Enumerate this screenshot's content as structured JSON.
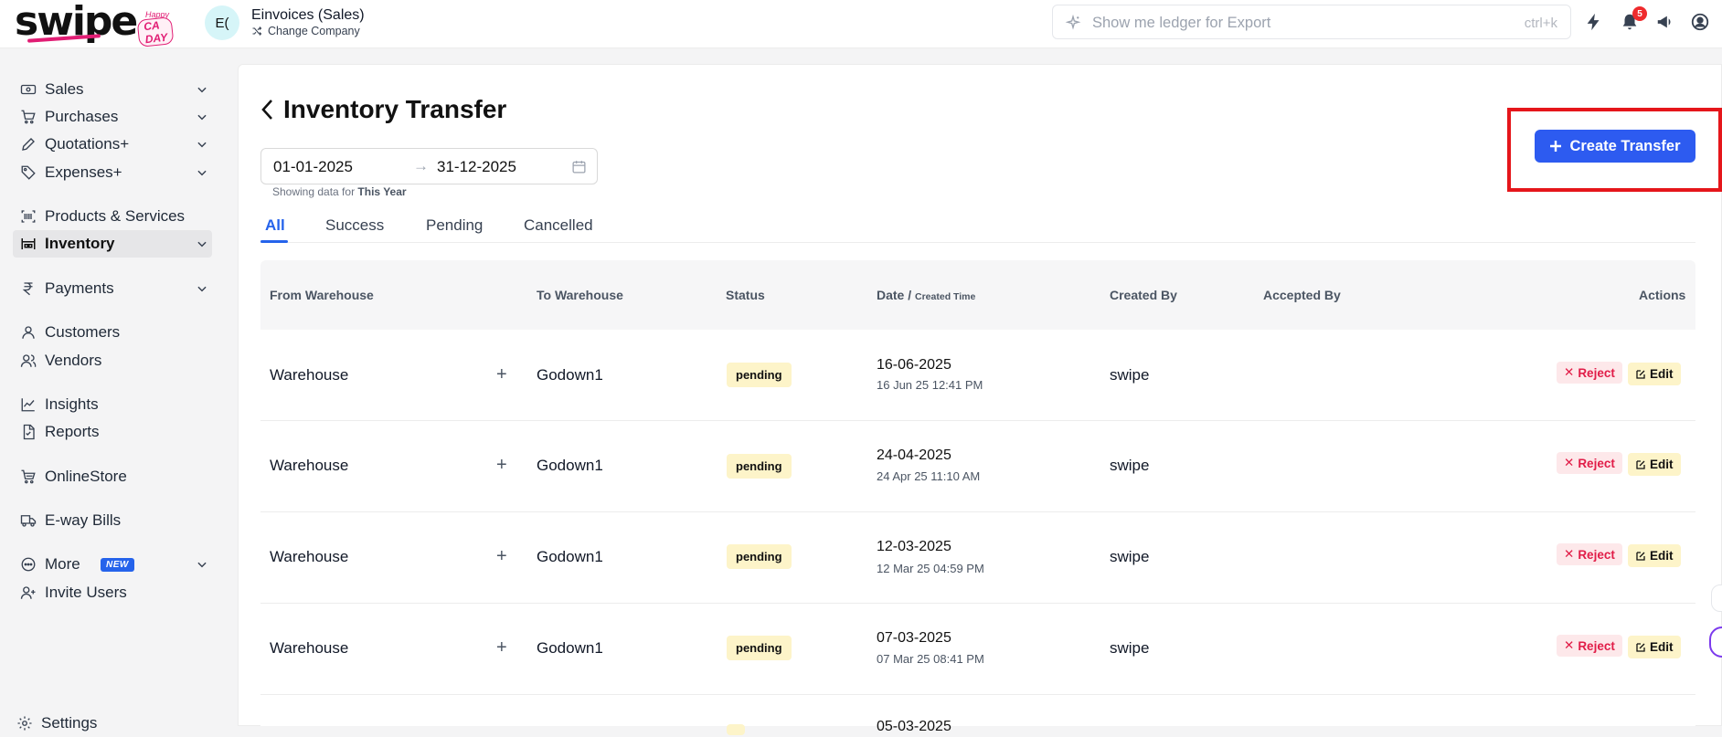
{
  "brand": {
    "word": "swipe",
    "happy": "Happy",
    "ca_day": "CA DAY"
  },
  "company": {
    "avatar": "E(",
    "name": "Einvoices (Sales)",
    "change": "Change Company"
  },
  "search": {
    "placeholder": "Show me ledger for Export",
    "shortcut": "ctrl+k"
  },
  "notifications": {
    "count": "5"
  },
  "sidebar": {
    "items": [
      {
        "label": "Sales"
      },
      {
        "label": "Purchases"
      },
      {
        "label": "Quotations+"
      },
      {
        "label": "Expenses+"
      },
      {
        "label": "Products & Services"
      },
      {
        "label": "Inventory"
      },
      {
        "label": "Payments"
      },
      {
        "label": "Customers"
      },
      {
        "label": "Vendors"
      },
      {
        "label": "Insights"
      },
      {
        "label": "Reports"
      },
      {
        "label": "OnlineStore"
      },
      {
        "label": "E-way Bills"
      },
      {
        "label": "More"
      },
      {
        "label": "Invite Users"
      },
      {
        "label": "Settings"
      }
    ],
    "new_badge": "NEW"
  },
  "page": {
    "title": "Inventory Transfer",
    "date_from": "01-01-2025",
    "date_to": "31-12-2025",
    "arrow": "→",
    "showing_prefix": "Showing data for",
    "showing_period": "This Year",
    "create_label": "Create Transfer"
  },
  "tabs": [
    {
      "label": "All"
    },
    {
      "label": "Success"
    },
    {
      "label": "Pending"
    },
    {
      "label": "Cancelled"
    }
  ],
  "table": {
    "headers": {
      "from": "From Warehouse",
      "to": "To Warehouse",
      "status": "Status",
      "date": "Date /",
      "date_sub": "Created Time",
      "created_by": "Created By",
      "accepted_by": "Accepted By",
      "actions": "Actions"
    },
    "rows": [
      {
        "from": "Warehouse",
        "to": "Godown1",
        "status": "pending",
        "date": "16-06-2025",
        "created": "16 Jun 25 12:41 PM",
        "created_by": "swipe"
      },
      {
        "from": "Warehouse",
        "to": "Godown1",
        "status": "pending",
        "date": "24-04-2025",
        "created": "24 Apr 25 11:10 AM",
        "created_by": "swipe"
      },
      {
        "from": "Warehouse",
        "to": "Godown1",
        "status": "pending",
        "date": "12-03-2025",
        "created": "12 Mar 25 04:59 PM",
        "created_by": "swipe"
      },
      {
        "from": "Warehouse",
        "to": "Godown1",
        "status": "pending",
        "date": "07-03-2025",
        "created": "07 Mar 25 08:41 PM",
        "created_by": "swipe"
      },
      {
        "date": "05-03-2025"
      }
    ],
    "reject_label": "Reject",
    "edit_label": "Edit"
  }
}
